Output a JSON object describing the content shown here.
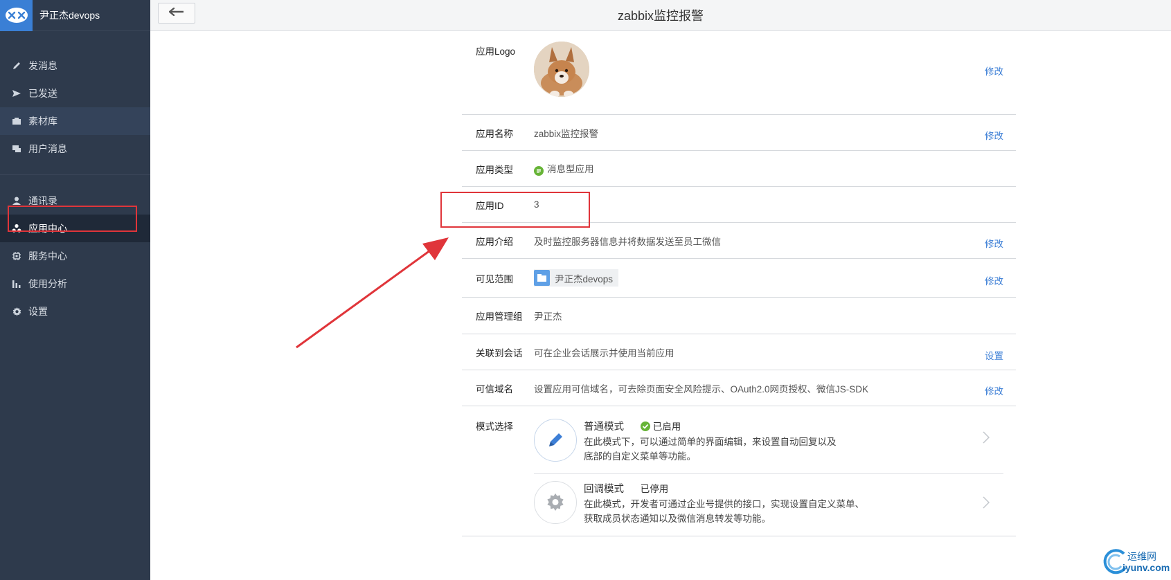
{
  "sidebar": {
    "brand_name": "尹正杰devops",
    "group1": [
      {
        "label": "发消息",
        "icon": "pencil-icon"
      },
      {
        "label": "已发送",
        "icon": "send-icon"
      },
      {
        "label": "素材库",
        "icon": "folder-icon"
      },
      {
        "label": "用户消息",
        "icon": "chat-icon"
      }
    ],
    "group2": [
      {
        "label": "通讯录",
        "icon": "user-icon"
      },
      {
        "label": "应用中心",
        "icon": "apps-icon"
      },
      {
        "label": "服务中心",
        "icon": "chip-icon"
      },
      {
        "label": "使用分析",
        "icon": "bar-chart-icon"
      },
      {
        "label": "设置",
        "icon": "gear-icon"
      }
    ]
  },
  "topbar": {
    "title": "zabbix监控报警"
  },
  "details": {
    "logo_label": "应用Logo",
    "logo_action": "修改",
    "name_label": "应用名称",
    "name_value": "zabbix监控报警",
    "name_action": "修改",
    "type_label": "应用类型",
    "type_value": "消息型应用",
    "id_label": "应用ID",
    "id_value": "3",
    "intro_label": "应用介绍",
    "intro_value": "及时监控服务器信息并将数据发送至员工微信",
    "intro_action": "修改",
    "scope_label": "可见范围",
    "scope_value": "尹正杰devops",
    "scope_action": "修改",
    "admin_label": "应用管理组",
    "admin_value": "尹正杰",
    "session_label": "关联到会话",
    "session_value": "可在企业会话展示并使用当前应用",
    "session_action": "设置",
    "domain_label": "可信域名",
    "domain_value": "设置应用可信域名，可去除页面安全风险提示、OAuth2.0网页授权、微信JS-SDK",
    "domain_action": "修改",
    "mode_label": "模式选择"
  },
  "modes": {
    "normal": {
      "title": "普通模式",
      "status": "已启用",
      "desc1": "在此模式下，可以通过简单的界面编辑，来设置自动回复以及",
      "desc2": "底部的自定义菜单等功能。"
    },
    "callback": {
      "title": "回调模式",
      "status": "已停用",
      "desc1": "在此模式，开发者可通过企业号提供的接口，实现设置自定义菜单、",
      "desc2": "获取成员状态通知以及微信消息转发等功能。"
    }
  },
  "watermark": {
    "cn": "运维网",
    "en": "iyunv.com"
  },
  "colors": {
    "sidebar": "#2e3a4c",
    "active": "#1f2938",
    "link": "#3d7fd6",
    "annotation": "#e0353a",
    "enabled": "#67b437"
  }
}
